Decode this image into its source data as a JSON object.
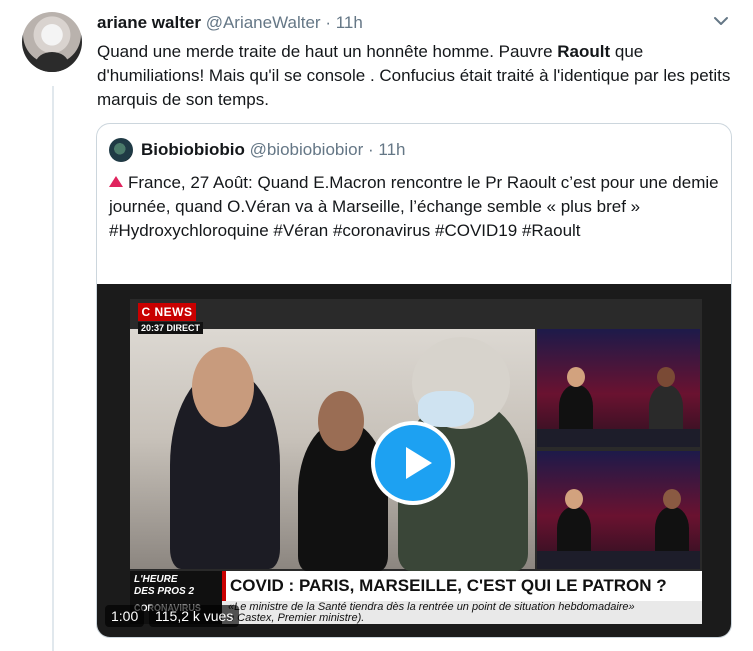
{
  "tweet": {
    "name": "ariane walter",
    "handle": "@ArianeWalter",
    "separator": "·",
    "time": "11h",
    "text_before": "Quand une merde traite de haut un honnête homme. Pauvre ",
    "text_bold": "Raoult",
    "text_after": " que d'humiliations! Mais qu'il se console . Confucius était traité à l'identique par les petits marquis de son temps."
  },
  "quoted": {
    "name": "Biobiobiobio",
    "handle": "@biobiobiobior",
    "separator": "·",
    "time": "11h",
    "text": "France, 27 Août: Quand E.Macron rencontre le Pr Raoult  c’est pour une demie journée, quand O.Véran va à Marseille, l’échange semble « plus bref » #Hydroxychloroquine #Véran #coronavirus #COVID19 #Raoult"
  },
  "video": {
    "channel": "C NEWS",
    "channel_sub": "20:37 DIRECT",
    "show_line1": "L'HEURE",
    "show_line2": "DES PROS 2",
    "headline": "COVID : PARIS, MARSEILLE, C'EST QUI LE PATRON ?",
    "ticker_label": "CORONAVIRUS",
    "ticker_line1": "«Le ministre de la Santé tiendra dès la rentrée un point de situation hebdomadaire»",
    "ticker_line2": "n Castex, Premier ministre).",
    "duration": "1:00",
    "views": "115,2 k vues"
  },
  "icons": {
    "more": "chevron-down-icon",
    "play": "play-icon",
    "alert": "red-triangle-icon"
  },
  "colors": {
    "accent": "#1da1f2",
    "text": "#14171a",
    "muted": "#657786",
    "border": "#ccd6dd",
    "alert": "#e0245e",
    "news_red": "#c90000"
  }
}
